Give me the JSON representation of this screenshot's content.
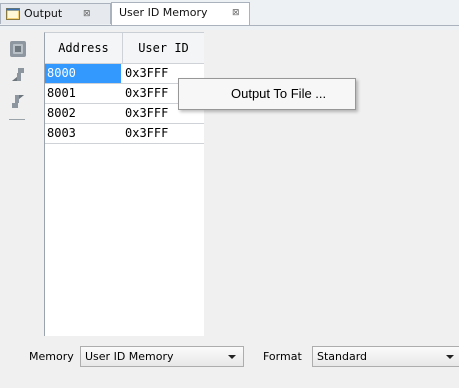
{
  "tabs": [
    {
      "label": "Output",
      "icon": "output-window-icon",
      "close": "⊠"
    },
    {
      "label": "User ID Memory",
      "close": "⊠"
    }
  ],
  "toolbar": {
    "icons": [
      "memory-read-icon",
      "download-arrow-icon",
      "upload-arrow-icon"
    ]
  },
  "table": {
    "columns": [
      "Address",
      "User ID"
    ],
    "rows": [
      {
        "address": "8000",
        "value": "0x3FFF"
      },
      {
        "address": "8001",
        "value": "0x3FFF"
      },
      {
        "address": "8002",
        "value": "0x3FFF"
      },
      {
        "address": "8003",
        "value": "0x3FFF"
      }
    ]
  },
  "context_menu": {
    "items": [
      "Output To File ..."
    ]
  },
  "bottom": {
    "memory_label": "Memory",
    "memory_value": "User ID Memory",
    "format_label": "Format",
    "format_value": "Standard"
  },
  "colors": {
    "selection": "#3399ff",
    "tab_border": "#aab3bd"
  }
}
